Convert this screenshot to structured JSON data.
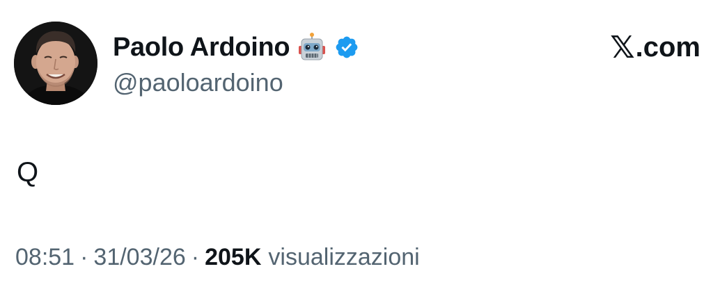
{
  "author": {
    "display_name": "Paolo Ardoino",
    "emoji_icon": "robot-face-icon",
    "verified_icon": "verified-badge-icon",
    "handle": "@paoloardoino"
  },
  "brand": {
    "x_glyph": "𝕏",
    "suffix": ".com"
  },
  "tweet": {
    "text": "Q"
  },
  "meta": {
    "time": "08:51",
    "separator": "·",
    "date": "31/03/26",
    "views_count": "205K",
    "views_label": "visualizzazioni"
  },
  "colors": {
    "text_primary": "#0f1419",
    "text_secondary": "#536471",
    "verified_blue": "#1d9bf0"
  }
}
